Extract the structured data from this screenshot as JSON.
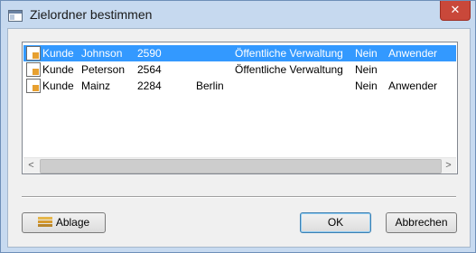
{
  "window": {
    "title": "Zielordner bestimmen",
    "close_glyph": "✕"
  },
  "list": {
    "rows": [
      {
        "icon": "document-chart-icon",
        "type": "Kunde",
        "name": "Johnson",
        "number": "2590",
        "city": "",
        "sector": "Öffentliche Verwaltung",
        "flag": "Nein",
        "role": "Anwender",
        "selected": true
      },
      {
        "icon": "document-chart-icon",
        "type": "Kunde",
        "name": "Peterson",
        "number": "2564",
        "city": "",
        "sector": "Öffentliche Verwaltung",
        "flag": "Nein",
        "role": "",
        "selected": false
      },
      {
        "icon": "document-chart-icon",
        "type": "Kunde",
        "name": "Mainz",
        "number": "2284",
        "city": "Berlin",
        "sector": "",
        "flag": "Nein",
        "role": "Anwender",
        "selected": false
      }
    ],
    "scroll_left_glyph": "<",
    "scroll_right_glyph": ">"
  },
  "buttons": {
    "ablage": "Ablage",
    "ok": "OK",
    "cancel": "Abbrechen"
  },
  "colors": {
    "selection": "#3399ff",
    "titlebar": "#c6d9ef",
    "close": "#c9483a"
  }
}
